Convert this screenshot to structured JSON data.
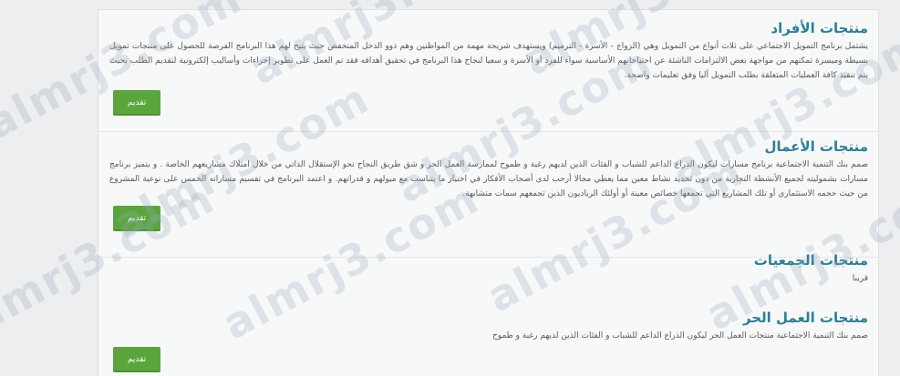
{
  "sections": [
    {
      "title": "منتجات الأفراد",
      "body": "يشتمل برنامج التمويل الاجتماعي على ثلاث أنواع من التمويل وهي (الزواج - الأسرة - الترميم) ويستهدف شريحة مهمة من المواطنين وهم ذوو الدخل المنخفض حيث يتيح لهم هذا البرنامج الفرصة للحصول على منتجات تمويل بسيطة وميسرة تمكنهم من مواجهة بعض الالتزامات الناشئة عن احتياجاتهم الأساسية سواء للفرد أو الأسرة و سعيا لنجاح هذا البرنامج في تحقيق أهدافه فقد تم العمل على تطوير إجراءات وأساليب إلكترونية لتقديم الطلب بحيث يتم تنفيذ كافة العمليات المتعلقة بطلب التمويل آليا وفق تعليمات واضحة.",
      "button": "تقديم"
    },
    {
      "title": "منتجات الأعمال",
      "body": "صمم بنك التنمية الاجتماعية برنامج مسارات ليكون الذراع الداعم للشباب و الفئات الذين لديهم رغبة و طموح لممارسة العمل الحر و شق طريق النجاح نحو الإستقلال الذاتي من خلال امتلاك مشاريعهم الخاصة . و يتميز برنامج مسارات بشموليته لجميع الأنشطة التجارية من دون تحديد نشاط معين مما يعطي مجالا أرحب لدى أصحاب الأفكار في اختيار ما يتناسب مع ميولهم و قدراتهم. و اعتمد البرنامج في تقسيم مساراته الخمس على نوعية المشروع من حيث حجمه الاستثماري أو تلك المشاريع التي تجمعها خصائص معينة أو أولئك الرياديون الذين تجمعهم سمات متشابهة.",
      "button": "تقديم"
    },
    {
      "title": "منتجات الجمعيات",
      "body": "قريبا"
    },
    {
      "title": "منتجات العمل الحر",
      "body": "صمم بنك التنمية الاجتماعية منتجات العمل الحر ليكون الذراع الداعم للشباب و الفئات الذين لديهم رغبة و طموح",
      "button": "تقديم"
    }
  ],
  "watermark": "almrj3.com"
}
